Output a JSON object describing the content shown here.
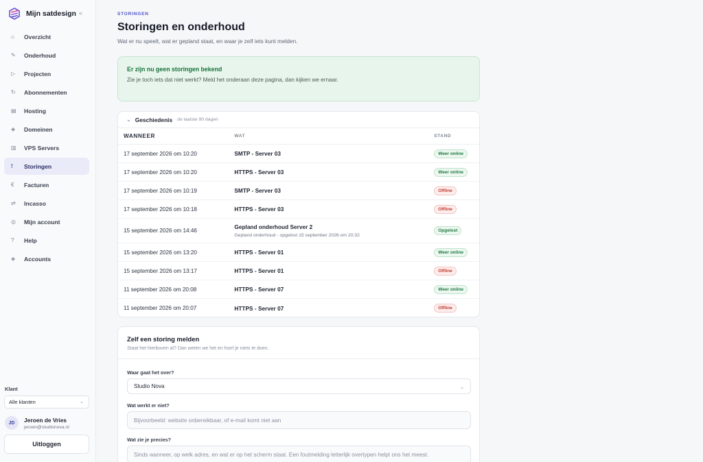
{
  "app": {
    "name": "Mijn satdesign",
    "collapse_glyph": "«"
  },
  "nav": {
    "items": [
      {
        "label": "Overzicht",
        "icon": "⌂",
        "icon_name": "home-icon"
      },
      {
        "label": "Onderhoud",
        "icon": "✎",
        "icon_name": "wrench-icon"
      },
      {
        "label": "Projecten",
        "icon": "▷",
        "icon_name": "play-icon"
      },
      {
        "label": "Abonnementen",
        "icon": "↻",
        "icon_name": "refresh-icon"
      },
      {
        "label": "Hosting",
        "icon": "▤",
        "icon_name": "server-icon"
      },
      {
        "label": "Domeinen",
        "icon": "◈",
        "icon_name": "globe-icon"
      },
      {
        "label": "VPS Servers",
        "icon": "▥",
        "icon_name": "vps-icon"
      },
      {
        "label": "Storingen",
        "icon": "!",
        "icon_name": "alert-icon"
      },
      {
        "label": "Facturen",
        "icon": "€",
        "icon_name": "euro-icon"
      },
      {
        "label": "Incasso",
        "icon": "⇄",
        "icon_name": "transfer-icon"
      },
      {
        "label": "Mijn account",
        "icon": "◎",
        "icon_name": "user-icon"
      },
      {
        "label": "Help",
        "icon": "?",
        "icon_name": "help-icon"
      },
      {
        "label": "Accounts",
        "icon": "◈",
        "icon_name": "accounts-icon"
      }
    ],
    "active_index": 7
  },
  "sidebar_footer": {
    "client_label": "Klant",
    "client_select": "Alle klanten",
    "user_initials": "JD",
    "user_name": "Jeroen de Vries",
    "user_email": "jeroen@studionova.nl",
    "logout_label": "Uitloggen"
  },
  "page": {
    "eyebrow": "STORINGEN",
    "title": "Storingen en onderhoud",
    "subtitle": "Wat er nu speelt, wat er gepland staat, en waar je zelf iets kunt melden."
  },
  "alert": {
    "title": "Er zijn nu geen storingen bekend",
    "text": "Zie je toch iets dat niet werkt? Meld het onderaan deze pagina, dan kijken we ernaar."
  },
  "history": {
    "title": "Geschiedenis",
    "note": "de laatste 90 dagen",
    "columns": [
      "WANNEER",
      "WAT",
      "STAND"
    ],
    "rows": [
      {
        "when": "17 september 2026 om 10:20",
        "what": "SMTP - Server 03",
        "sub": "",
        "status": "Weer online",
        "kind": "online"
      },
      {
        "when": "17 september 2026 om 10:20",
        "what": "HTTPS - Server 03",
        "sub": "",
        "status": "Weer online",
        "kind": "online"
      },
      {
        "when": "17 september 2026 om 10:19",
        "what": "SMTP - Server 03",
        "sub": "",
        "status": "Offline",
        "kind": "offline"
      },
      {
        "when": "17 september 2026 om 10:18",
        "what": "HTTPS - Server 03",
        "sub": "",
        "status": "Offline",
        "kind": "offline"
      },
      {
        "when": "15 september 2026 om 14:46",
        "what": "Gepland onderhoud Server 2",
        "sub": "Gepland onderhoud - opgelost 15 september 2026 om 20:32",
        "status": "Opgelost",
        "kind": "resolved"
      },
      {
        "when": "15 september 2026 om 13:20",
        "what": "HTTPS - Server 01",
        "sub": "",
        "status": "Weer online",
        "kind": "online"
      },
      {
        "when": "15 september 2026 om 13:17",
        "what": "HTTPS - Server 01",
        "sub": "",
        "status": "Offline",
        "kind": "offline"
      },
      {
        "when": "11 september 2026 om 20:08",
        "what": "HTTPS - Server 07",
        "sub": "",
        "status": "Weer online",
        "kind": "online"
      },
      {
        "when": "11 september 2026 om 20:07",
        "what": "HTTPS - Server 07",
        "sub": "",
        "status": "Offline",
        "kind": "offline"
      }
    ]
  },
  "report": {
    "title": "Zelf een storing melden",
    "subtitle": "Staat het hierboven al? Dan weten we het en hoef je niets te doen.",
    "field1_label": "Waar gaat het over?",
    "field1_value": "Studio Nova",
    "field2_label": "Wat werkt er niet?",
    "field2_placeholder": "Bijvoorbeeld: website onbereikbaar, of e-mail komt niet aan",
    "field3_label": "Wat zie je precies?",
    "field3_placeholder": "Sinds wanneer, op welk adres, en wat er op het scherm staat. Een foutmelding letterlijk overtypen helpt ons het meest."
  },
  "colors": {
    "accent": "#4b52c7",
    "success": "#17743c",
    "danger": "#c0392b"
  }
}
